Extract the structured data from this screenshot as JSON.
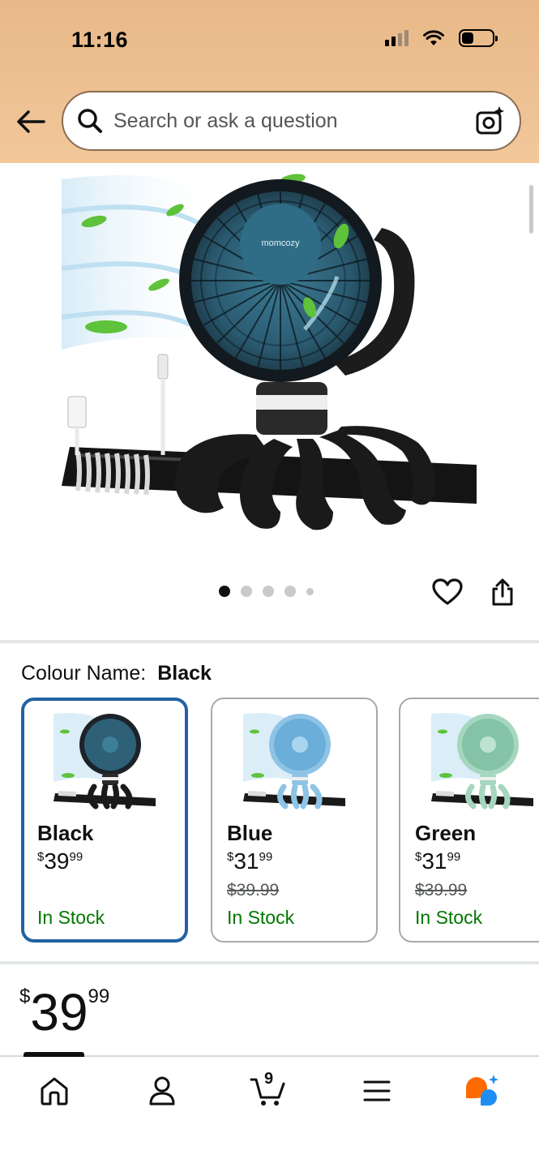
{
  "status_bar": {
    "time": "11:16"
  },
  "search": {
    "placeholder": "Search or ask a question"
  },
  "product": {
    "brand_on_image": "momcozy"
  },
  "gallery": {
    "dot_count": 5,
    "active_index": 0
  },
  "colour": {
    "label": "Colour Name:",
    "selected": "Black"
  },
  "variants": [
    {
      "name": "Black",
      "currency": "$",
      "price_whole": "39",
      "price_fraction": "99",
      "list_price": "",
      "stock": "In Stock",
      "color": "#1f2a30"
    },
    {
      "name": "Blue",
      "currency": "$",
      "price_whole": "31",
      "price_fraction": "99",
      "list_price": "$39.99",
      "stock": "In Stock",
      "color": "#8fc3e6"
    },
    {
      "name": "Green",
      "currency": "$",
      "price_whole": "31",
      "price_fraction": "99",
      "list_price": "$39.99",
      "stock": "In Stock",
      "color": "#a6d6bf"
    }
  ],
  "price": {
    "currency": "$",
    "whole": "39",
    "fraction": "99"
  },
  "bottom_nav": {
    "items": [
      {
        "name": "home-icon",
        "active": true
      },
      {
        "name": "account-icon",
        "active": false
      },
      {
        "name": "cart-icon",
        "active": false
      },
      {
        "name": "menu-icon",
        "active": false
      },
      {
        "name": "rufus-assistant-icon",
        "active": false
      }
    ],
    "cart_count": "9"
  },
  "colors": {
    "header_bg": "#f2c79a",
    "selected_border": "#2162a1",
    "in_stock": "#007600",
    "assistant_orange": "#ff6a00",
    "assistant_blue": "#1f8ef1"
  }
}
